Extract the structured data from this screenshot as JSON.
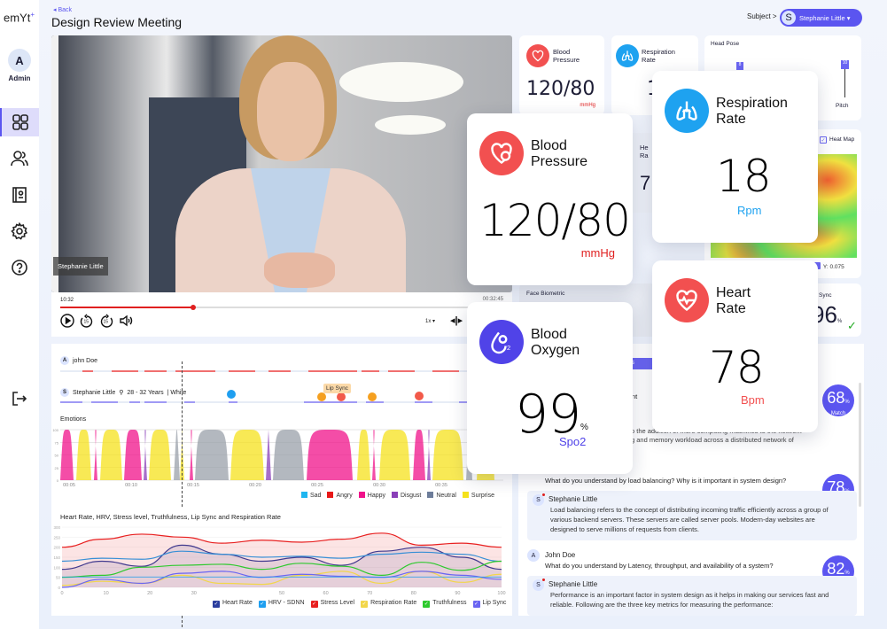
{
  "app": {
    "logo": "emYt",
    "logo_sup": "+"
  },
  "sidebar": {
    "avatar_initial": "A",
    "user_label": "Admin",
    "items": [
      {
        "name": "dashboard",
        "icon": "grid-icon",
        "active": true
      },
      {
        "name": "users",
        "icon": "users-icon"
      },
      {
        "name": "reports",
        "icon": "contact-card-icon"
      },
      {
        "name": "settings",
        "icon": "gear-icon"
      },
      {
        "name": "help",
        "icon": "help-circle-icon"
      }
    ],
    "logout_icon": "logout-icon"
  },
  "header": {
    "back_label": "◂ Back",
    "title": "Design Review Meeting",
    "subject_label": "Subject >",
    "subject_initial": "S",
    "subject_name": "Stephanie Little ▾"
  },
  "video": {
    "name_tag": "Stephanie Little",
    "current_time": "10:32",
    "duration": "00:32:45",
    "progress": 0.3,
    "speed": "1x ▾",
    "split_icon": "◂|▸"
  },
  "timeline": {
    "speaker1": {
      "initial": "A",
      "name": "john Doe"
    },
    "speaker2": {
      "initial": "S",
      "name": "Stephanie Little",
      "age": "28 - 32 Years",
      "ethnicity": "| White"
    },
    "lip_sync_tag": "Lip Sync",
    "emotions_title": "Emotions",
    "emotions_xticks": [
      "00:05",
      "00:10",
      "00:15",
      "00:20",
      "00:25",
      "00:30",
      "00:35"
    ],
    "emotions_yticks": [
      "100",
      "75",
      "50",
      "25",
      "0"
    ],
    "emotions_legend": [
      {
        "label": "Sad",
        "color": "#1fb6f0"
      },
      {
        "label": "Angry",
        "color": "#e81818"
      },
      {
        "label": "Happy",
        "color": "#f0128a"
      },
      {
        "label": "Disgust",
        "color": "#8a3fb8"
      },
      {
        "label": "Neutral",
        "color": "#6d7d9a"
      },
      {
        "label": "Surprise",
        "color": "#f5e21c"
      }
    ]
  },
  "chart_data": {
    "type": "line",
    "title": "Heart Rate, HRV, Stress level, Truthfulness, Lip Sync and Respiration Rate",
    "x": [
      0,
      10,
      20,
      30,
      40,
      50,
      60,
      70,
      80,
      90,
      100
    ],
    "ylim": [
      0,
      300
    ],
    "xticks": [
      "0",
      "10",
      "20",
      "30",
      "50",
      "60",
      "70",
      "80",
      "90",
      "100"
    ],
    "yticks": [
      "300",
      "250",
      "200",
      "150",
      "100",
      "50",
      "0"
    ],
    "series": [
      {
        "name": "Heart Rate",
        "color": "#2b3e9e",
        "values": [
          90,
          130,
          105,
          210,
          165,
          130,
          150,
          110,
          180,
          200,
          150,
          90
        ]
      },
      {
        "name": "HRV - SDNN",
        "color": "#1f9ff0",
        "values": [
          130,
          145,
          140,
          180,
          165,
          150,
          155,
          145,
          165,
          175,
          165,
          130
        ]
      },
      {
        "name": "Stress Level",
        "color": "#e82020",
        "values": [
          200,
          240,
          265,
          250,
          220,
          235,
          225,
          240,
          270,
          210,
          220,
          200
        ]
      },
      {
        "name": "Respiration Rate",
        "color": "#f2d64a",
        "values": [
          10,
          30,
          20,
          60,
          20,
          15,
          60,
          80,
          20,
          80,
          25,
          65
        ]
      },
      {
        "name": "Truthfulness",
        "color": "#2ec92e",
        "values": [
          50,
          60,
          100,
          110,
          115,
          90,
          120,
          105,
          60,
          125,
          85,
          130
        ]
      },
      {
        "name": "Lip Sync",
        "color": "#6a65f2",
        "values": [
          0,
          40,
          20,
          70,
          80,
          50,
          65,
          55,
          50,
          80,
          60,
          40
        ]
      }
    ]
  },
  "vitals_bg": {
    "bp": {
      "label1": "Blood",
      "label2": "Pressure",
      "value": "120/80",
      "unit": "mmHg"
    },
    "resp": {
      "label1": "Respiration",
      "label2": "Rate",
      "value": "1"
    },
    "head_pose": {
      "title": "Head Pose",
      "yaw_value": "8",
      "pitch_value": "10",
      "pitch_label": "Pitch"
    },
    "heart": {
      "label1": "He",
      "label2": "Ra",
      "value": "7"
    },
    "heatmap": {
      "label": "Heat Map",
      "x_readout": "75",
      "y_readout": "Y: 0.075"
    },
    "face_biometric": "Face Biometric",
    "lip_sync": {
      "title": "Sync",
      "value": "96",
      "unit": "%"
    }
  },
  "vitals_popups": {
    "blood_pressure": {
      "label1": "Blood",
      "label2": "Pressure",
      "value": "120/80",
      "unit": "mmHg"
    },
    "respiration": {
      "label1": "Respiration",
      "label2": "Rate",
      "value": "18",
      "unit": "Rpm"
    },
    "heart_rate": {
      "label1": "Heart",
      "label2": "Rate",
      "value": "78",
      "unit": "Bpm"
    },
    "blood_oxygen": {
      "label1": "Blood",
      "label2": "Oxygen",
      "value": "99",
      "pct": "%",
      "unit": "Spo2"
    }
  },
  "qa": {
    "tab_label": "ions",
    "partial_q": "ferent",
    "partial_ans1": "o the addition of more computing machines to the network",
    "partial_ans2": "g and memory workload across a distributed network of",
    "items": [
      {
        "match": "68",
        "match_label": "Match"
      },
      {
        "question": "What do you understand by load balancing? Why is it important in system design?",
        "match": "78",
        "match_label": "Match",
        "answer_name": "Stephanie Little",
        "answer_initial": "S",
        "answer": "Load balancing refers to the concept of distributing incoming traffic efficiently across a group of various backend servers. These servers are called server pools. Modern-day websites are designed to serve millions of requests from clients."
      },
      {
        "asker_initial": "A",
        "asker": "John Doe",
        "question": "What do you understand by Latency, throughput, and availability of a system?",
        "match": "82",
        "match_label": "Match",
        "answer_name": "Stephanie Little",
        "answer_initial": "S",
        "answer": "Performance is an important factor in system design as it helps in making our services fast and reliable. Following are the three key metrics for measuring the performance:"
      }
    ]
  }
}
